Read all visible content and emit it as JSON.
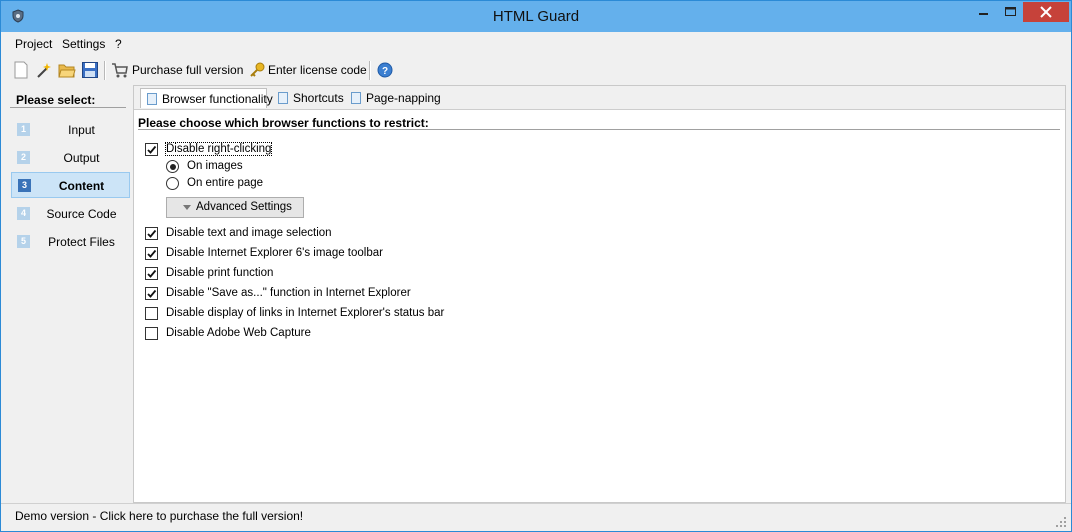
{
  "window": {
    "title": "HTML Guard",
    "accent": "#64b0ec",
    "close_color": "#c6423a"
  },
  "menu": [
    {
      "label": "Project"
    },
    {
      "label": "Settings"
    },
    {
      "label": "?"
    }
  ],
  "toolbar": {
    "purchase_label": "Purchase full version",
    "license_label": "Enter license code",
    "icons": [
      "new-file-icon",
      "wizard-icon",
      "open-folder-icon",
      "save-icon",
      "cart-icon",
      "key-icon",
      "help-icon"
    ]
  },
  "sidebar": {
    "title": "Please select:",
    "items": [
      {
        "num": "1",
        "label": "Input",
        "selected": false
      },
      {
        "num": "2",
        "label": "Output",
        "selected": false
      },
      {
        "num": "3",
        "label": "Content",
        "selected": true
      },
      {
        "num": "4",
        "label": "Source Code",
        "selected": false
      },
      {
        "num": "5",
        "label": "Protect Files",
        "selected": false
      }
    ]
  },
  "tabs": [
    {
      "label": "Browser functionality",
      "active": true
    },
    {
      "label": "Shortcuts",
      "active": false
    },
    {
      "label": "Page-napping",
      "active": false
    }
  ],
  "content": {
    "heading": "Please choose which browser functions to restrict:",
    "right_click": {
      "label": "Disable right-clicking",
      "checked": true
    },
    "radios": [
      {
        "label": "On images",
        "selected": true
      },
      {
        "label": "On entire page",
        "selected": false
      }
    ],
    "advanced_label": "Advanced Settings",
    "options": [
      {
        "label": "Disable text and image selection",
        "checked": true
      },
      {
        "label": "Disable Internet Explorer 6's image toolbar",
        "checked": true
      },
      {
        "label": "Disable print function",
        "checked": true
      },
      {
        "label": "Disable \"Save as...\" function in Internet Explorer",
        "checked": true
      },
      {
        "label": "Disable display of links in Internet Explorer's status bar",
        "checked": false
      },
      {
        "label": "Disable Adobe Web Capture",
        "checked": false
      }
    ]
  },
  "status": {
    "text": "Demo version - Click here to purchase the full version!"
  }
}
